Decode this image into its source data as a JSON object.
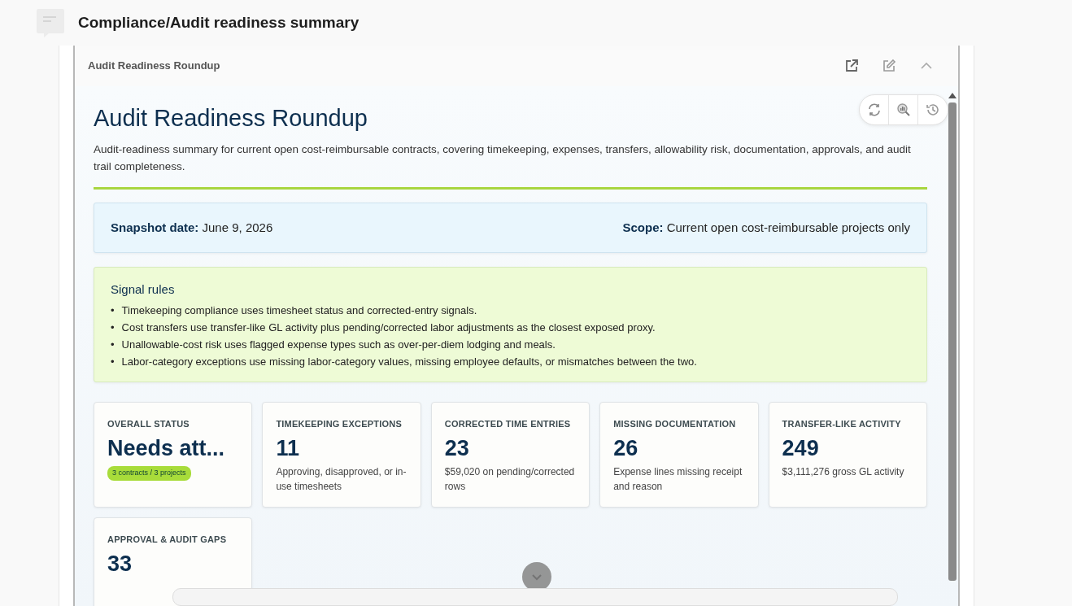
{
  "page": {
    "title": "Compliance/Audit readiness summary"
  },
  "panel": {
    "title": "Audit Readiness Roundup"
  },
  "report": {
    "title": "Audit Readiness Roundup",
    "description": "Audit-readiness summary for current open cost-reimbursable contracts, covering timekeeping, expenses, transfers, allowability risk, documentation, approvals, and audit trail completeness.",
    "snapshot": {
      "label": "Snapshot date:",
      "value": "June 9, 2026"
    },
    "scope": {
      "label": "Scope:",
      "value": "Current open cost-reimbursable projects only"
    },
    "rules": {
      "title": "Signal rules",
      "bullet": "•",
      "items": [
        "Timekeeping compliance uses timesheet status and corrected-entry signals.",
        "Cost transfers use transfer-like GL activity plus pending/corrected labor adjustments as the closest exposed proxy.",
        "Unallowable-cost risk uses flagged expense types such as over-per-diem lodging and meals.",
        "Labor-category exceptions use missing labor-category values, missing employee defaults, or mismatches between the two."
      ]
    },
    "cards": [
      {
        "label": "OVERALL STATUS",
        "value": "Needs att...",
        "badge": "3 contracts / 3 projects"
      },
      {
        "label": "TIMEKEEPING EXCEPTIONS",
        "value": "11",
        "note": "Approving, disapproved, or in-use timesheets"
      },
      {
        "label": "CORRECTED TIME ENTRIES",
        "value": "23",
        "note": "$59,020 on pending/corrected rows"
      },
      {
        "label": "MISSING DOCUMENTATION",
        "value": "26",
        "note": "Expense lines missing receipt and reason"
      },
      {
        "label": "TRANSFER-LIKE ACTIVITY",
        "value": "249",
        "note": "$3,111,276 gross GL activity"
      },
      {
        "label": "APPROVAL & AUDIT GAPS",
        "value": "33"
      }
    ]
  }
}
